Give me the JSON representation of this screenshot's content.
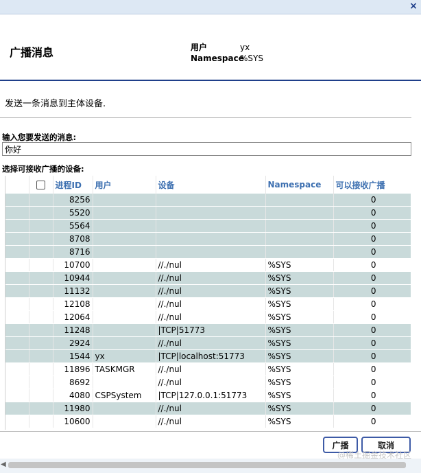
{
  "window": {
    "close_label": "×"
  },
  "header": {
    "title": "广播消息",
    "user_label": "用户",
    "user_value": "yx",
    "namespace_label": "Namespace",
    "namespace_value": "%SYS"
  },
  "description": "发送一条消息到主体设备.",
  "message": {
    "label": "输入您要发送的消息:",
    "value": "你好"
  },
  "devices": {
    "label": "选择可接收广播的设备:",
    "columns": [
      "进程ID",
      "用户",
      "设备",
      "Namespace",
      "可以接收广播"
    ],
    "rows": [
      {
        "pid": "8256",
        "user": "",
        "device": "",
        "namespace": "",
        "can_receive": "0",
        "shade": true
      },
      {
        "pid": "5520",
        "user": "",
        "device": "",
        "namespace": "",
        "can_receive": "0",
        "shade": true
      },
      {
        "pid": "5564",
        "user": "",
        "device": "",
        "namespace": "",
        "can_receive": "0",
        "shade": true
      },
      {
        "pid": "8708",
        "user": "",
        "device": "",
        "namespace": "",
        "can_receive": "0",
        "shade": true
      },
      {
        "pid": "8716",
        "user": "",
        "device": "",
        "namespace": "",
        "can_receive": "0",
        "shade": true
      },
      {
        "pid": "10700",
        "user": "",
        "device": "//./nul",
        "namespace": "%SYS",
        "can_receive": "0",
        "shade": false
      },
      {
        "pid": "10944",
        "user": "",
        "device": "//./nul",
        "namespace": "%SYS",
        "can_receive": "0",
        "shade": true
      },
      {
        "pid": "11132",
        "user": "",
        "device": "//./nul",
        "namespace": "%SYS",
        "can_receive": "0",
        "shade": true
      },
      {
        "pid": "12108",
        "user": "",
        "device": "//./nul",
        "namespace": "%SYS",
        "can_receive": "0",
        "shade": false
      },
      {
        "pid": "12064",
        "user": "",
        "device": "//./nul",
        "namespace": "%SYS",
        "can_receive": "0",
        "shade": false
      },
      {
        "pid": "11248",
        "user": "",
        "device": "|TCP|51773",
        "namespace": "%SYS",
        "can_receive": "0",
        "shade": true
      },
      {
        "pid": "2924",
        "user": "",
        "device": "//./nul",
        "namespace": "%SYS",
        "can_receive": "0",
        "shade": true
      },
      {
        "pid": "1544",
        "user": "yx",
        "device": "|TCP|localhost:51773",
        "namespace": "%SYS",
        "can_receive": "0",
        "shade": true
      },
      {
        "pid": "11896",
        "user": "TASKMGR",
        "device": "//./nul",
        "namespace": "%SYS",
        "can_receive": "0",
        "shade": false
      },
      {
        "pid": "8692",
        "user": "",
        "device": "//./nul",
        "namespace": "%SYS",
        "can_receive": "0",
        "shade": false
      },
      {
        "pid": "4080",
        "user": "CSPSystem",
        "device": "|TCP|127.0.0.1:51773",
        "namespace": "%SYS",
        "can_receive": "0",
        "shade": false
      },
      {
        "pid": "11980",
        "user": "",
        "device": "//./nul",
        "namespace": "%SYS",
        "can_receive": "0",
        "shade": true
      },
      {
        "pid": "10600",
        "user": "",
        "device": "//./nul",
        "namespace": "%SYS",
        "can_receive": "0",
        "shade": false
      }
    ]
  },
  "buttons": {
    "broadcast": "广播",
    "cancel": "取消"
  },
  "watermark": "@稀土掘金技术社区"
}
